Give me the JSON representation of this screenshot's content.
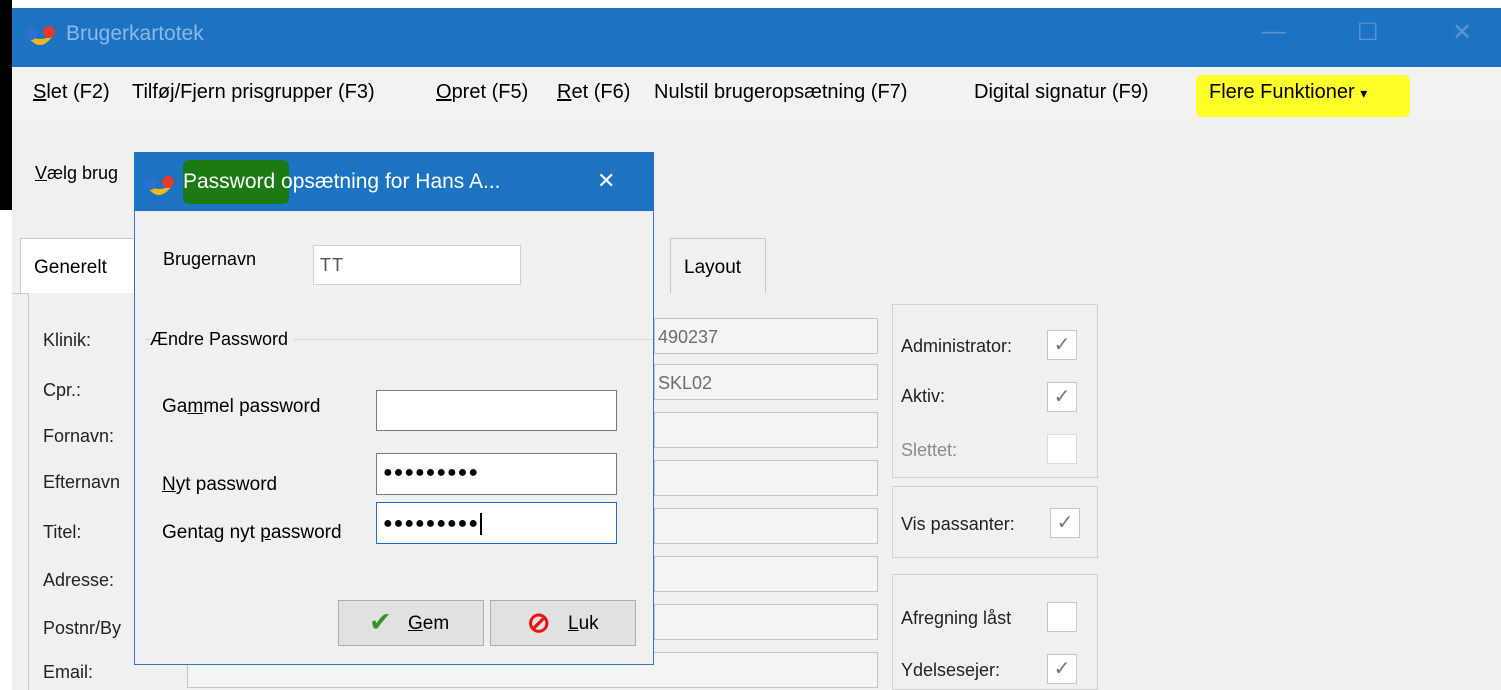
{
  "window": {
    "title": "Brugerkartotek",
    "minimize": "—",
    "maximize": "☐",
    "close": "✕"
  },
  "menu": {
    "slet": {
      "k": "S",
      "rest": "let (F2)"
    },
    "tilfoj": "Tilføj/Fjern prisgrupper (F3)",
    "opret": {
      "k": "O",
      "rest": "pret (F5)"
    },
    "ret": {
      "k": "R",
      "rest": "et (F6)"
    },
    "nulstil": "Nulstil brugeropsætning (F7)",
    "digital": "Digital signatur (F9)",
    "flere": "Flere Funktioner",
    "flere_arrow": "▾"
  },
  "vaelg": {
    "k": "V",
    "rest": "ælg brug"
  },
  "tabs": {
    "generelt": "Generelt",
    "layout": "Layout"
  },
  "labels": {
    "klinik": "Klinik:",
    "cpr": "Cpr.:",
    "fornavn": "Fornavn:",
    "efternavn": "Efternavn",
    "titel": "Titel:",
    "adresse": "Adresse:",
    "postnr": "Postnr/By",
    "email": "Email:"
  },
  "fields": {
    "field1": "490237",
    "field2": "SKL02"
  },
  "checks": {
    "administrator": {
      "label": "Administrator:",
      "checked": true
    },
    "aktiv": {
      "label": "Aktiv:",
      "checked": true
    },
    "slettet": {
      "label": "Slettet:",
      "checked": false
    },
    "vis_passanter": {
      "label": "Vis passanter:",
      "checked": true
    },
    "afregning": {
      "label": "Afregning låst",
      "checked": false
    },
    "ydelsesejer": {
      "label": "Ydelsesejer:",
      "checked": true
    },
    "check_glyph": "✓"
  },
  "dialog": {
    "title_highlight": "Password",
    "title_rest": " opsætning for Hans A...",
    "close": "✕",
    "brugernavn_label": "Brugernavn",
    "brugernavn_value": "TT",
    "group_label": "Ændre Password",
    "gammel": {
      "a": "Ga",
      "k": "m",
      "b": "mel password",
      "value": ""
    },
    "nyt": {
      "k": "N",
      "b": "yt password",
      "value": "●●●●●●●●●"
    },
    "gentag": {
      "a": "Gentag nyt ",
      "k": "p",
      "b": "assword",
      "value": "●●●●●●●●●"
    },
    "gem": {
      "icon": "✔",
      "k": "G",
      "rest": "em"
    },
    "luk": {
      "icon": "⊘",
      "k": "L",
      "rest": "uk"
    }
  },
  "colors": {
    "titlebar": "#1b73c2",
    "highlight_yellow": "#ffff2a",
    "highlight_green": "#1c7a14"
  }
}
